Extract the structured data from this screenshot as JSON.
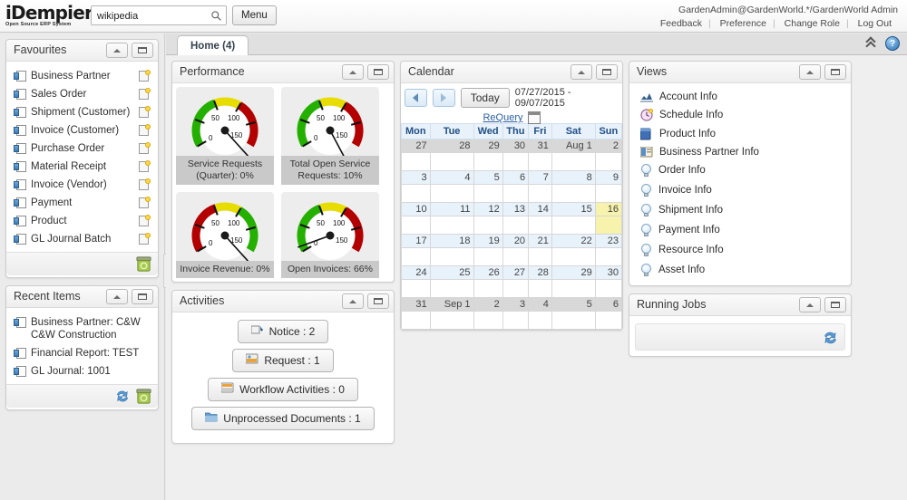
{
  "header": {
    "logo_main": "iDempiere",
    "logo_sub": "Open Source  ERP System",
    "search_value": "wikipedia",
    "search_placeholder": "",
    "search_icon": "search-icon",
    "menu_label": "Menu",
    "user_line": "GardenAdmin@GardenWorld.*/GardenWorld Admin",
    "links": [
      "Feedback",
      "Preference",
      "Change Role",
      "Log Out"
    ]
  },
  "tabbar": {
    "tabs": [
      {
        "label": "Home (4)"
      }
    ],
    "collapse_icon": "double-chevron-up-icon",
    "help_icon": "help-icon",
    "help_glyph": "?"
  },
  "sidebar": {
    "favourites": {
      "title": "Favourites",
      "collapse_label": "",
      "maximize_label": "",
      "items": [
        {
          "label": "Business Partner"
        },
        {
          "label": "Sales Order"
        },
        {
          "label": "Shipment (Customer)"
        },
        {
          "label": "Invoice (Customer)"
        },
        {
          "label": "Purchase Order"
        },
        {
          "label": "Material Receipt"
        },
        {
          "label": "Invoice (Vendor)"
        },
        {
          "label": "Payment"
        },
        {
          "label": "Product"
        },
        {
          "label": "GL Journal Batch"
        }
      ]
    },
    "recent_items": {
      "title": "Recent Items",
      "items": [
        {
          "label": "Business Partner: C&W C&W Construction"
        },
        {
          "label": "Financial Report: TEST"
        },
        {
          "label": "GL Journal: 1001"
        }
      ]
    }
  },
  "performance": {
    "title": "Performance",
    "gauges": [
      {
        "caption": "Service Requests (Quarter): 0%",
        "percent": 0,
        "needle_deg": -132,
        "scheme": "green-left",
        "ticks": [
          "0",
          "50",
          "100",
          "150"
        ]
      },
      {
        "caption": "Total Open Service Requests: 10%",
        "percent": 10,
        "needle_deg": -118,
        "scheme": "green-left",
        "ticks": [
          "0",
          "50",
          "100",
          "150"
        ]
      },
      {
        "caption": "Invoice Revenue: 0%",
        "percent": 0,
        "needle_deg": -132,
        "scheme": "red-left",
        "ticks": [
          "0",
          "50",
          "100",
          "150"
        ]
      },
      {
        "caption": "Open Invoices: 66%",
        "percent": 66,
        "needle_deg": -20,
        "scheme": "green-left",
        "ticks": [
          "0",
          "50",
          "100",
          "150"
        ]
      }
    ]
  },
  "activities": {
    "title": "Activities",
    "buttons": [
      {
        "label": "Notice : 2",
        "icon": "notice-icon"
      },
      {
        "label": "Request : 1",
        "icon": "request-icon"
      },
      {
        "label": "Workflow Activities : 0",
        "icon": "workflow-icon"
      },
      {
        "label": "Unprocessed Documents : 1",
        "icon": "folder-icon"
      }
    ]
  },
  "calendar": {
    "title": "Calendar",
    "prev_label": "",
    "next_label": "",
    "today_label": "Today",
    "range": "07/27/2015 - 09/07/2015",
    "requery_label": "ReQuery",
    "calendar_icon": "calendar-icon",
    "weekdays": [
      "Mon",
      "Tue",
      "Wed",
      "Thu",
      "Fri",
      "Sat",
      "Sun"
    ],
    "weeks": [
      {
        "style": "gray",
        "days": [
          "27",
          "28",
          "29",
          "30",
          "31",
          "Aug 1",
          "2"
        ],
        "today_index": -1
      },
      {
        "style": "num",
        "days": [
          "3",
          "4",
          "5",
          "6",
          "7",
          "8",
          "9"
        ],
        "today_index": -1
      },
      {
        "style": "num",
        "days": [
          "10",
          "11",
          "12",
          "13",
          "14",
          "15",
          "16"
        ],
        "today_index": 6
      },
      {
        "style": "num",
        "days": [
          "17",
          "18",
          "19",
          "20",
          "21",
          "22",
          "23"
        ],
        "today_index": -1
      },
      {
        "style": "num",
        "days": [
          "24",
          "25",
          "26",
          "27",
          "28",
          "29",
          "30"
        ],
        "today_index": -1
      },
      {
        "style": "gray",
        "days": [
          "31",
          "Sep 1",
          "2",
          "3",
          "4",
          "5",
          "6"
        ],
        "today_index": -1
      }
    ]
  },
  "views": {
    "title": "Views",
    "items": [
      {
        "label": "Account Info",
        "icon": "chart-icon"
      },
      {
        "label": "Schedule Info",
        "icon": "clock-icon"
      },
      {
        "label": "Product Info",
        "icon": "product-icon"
      },
      {
        "label": "Business Partner Info",
        "icon": "card-icon"
      },
      {
        "label": "Order Info",
        "icon": "bulb-icon"
      },
      {
        "label": "Invoice Info",
        "icon": "bulb-icon"
      },
      {
        "label": "Shipment Info",
        "icon": "bulb-icon"
      },
      {
        "label": "Payment Info",
        "icon": "bulb-icon"
      },
      {
        "label": "Resource Info",
        "icon": "bulb-icon"
      },
      {
        "label": "Asset Info",
        "icon": "bulb-icon"
      }
    ]
  },
  "running_jobs": {
    "title": "Running Jobs",
    "refresh_icon": "refresh-icon"
  },
  "colors": {
    "gauge_green": "#24b000",
    "gauge_yellow": "#e8dd00",
    "gauge_red": "#b30000",
    "today_highlight": "#f7f2ac",
    "calendar_header": "#1f4e86",
    "link": "#2b5fa8"
  }
}
